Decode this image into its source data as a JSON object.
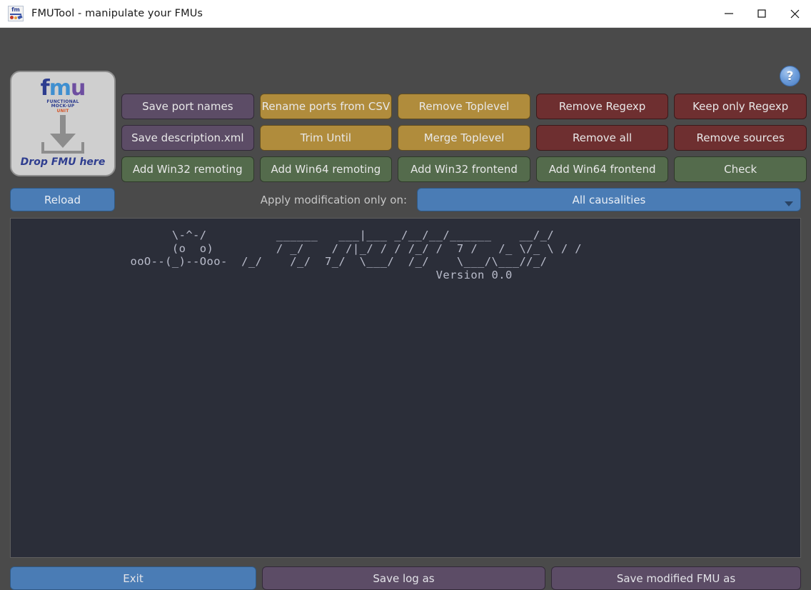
{
  "window": {
    "title": "FMUTool - manipulate your FMUs",
    "icon": "fmutool-app-icon",
    "controls": {
      "minimize": "minimize-icon",
      "maximize": "maximize-icon",
      "close": "close-icon"
    }
  },
  "help": {
    "label": "?"
  },
  "dropzone": {
    "logo_f": "f",
    "logo_m": "m",
    "logo_u": "u",
    "sub_line1": "FUNCTIONAL",
    "sub_line2": "MOCK-UP",
    "sub_line3": "UNIT",
    "caption": "Drop FMU here"
  },
  "buttons": {
    "rows": [
      [
        {
          "label": "Save port names",
          "color": "purple"
        },
        {
          "label": "Rename ports from CSV",
          "color": "gold"
        },
        {
          "label": "Remove Toplevel",
          "color": "gold"
        },
        {
          "label": "Remove Regexp",
          "color": "red"
        },
        {
          "label": "Keep only Regexp",
          "color": "red"
        }
      ],
      [
        {
          "label": "Save description.xml",
          "color": "purple"
        },
        {
          "label": "Trim Until",
          "color": "gold"
        },
        {
          "label": "Merge Toplevel",
          "color": "gold"
        },
        {
          "label": "Remove all",
          "color": "red"
        },
        {
          "label": "Remove sources",
          "color": "red"
        }
      ],
      [
        {
          "label": "Add Win32 remoting",
          "color": "green"
        },
        {
          "label": "Add Win64 remoting",
          "color": "green"
        },
        {
          "label": "Add Win32 frontend",
          "color": "green"
        },
        {
          "label": "Add Win64 frontend",
          "color": "green"
        },
        {
          "label": "Check",
          "color": "green"
        }
      ]
    ]
  },
  "apply_row": {
    "reload_label": "Reload",
    "apply_label": "Apply modification only on:",
    "causality_selected": "All causalities",
    "caret_icon": "chevron-down-icon"
  },
  "log": {
    "ascii_art": "        \\-^-/          ______   ___|___ _/__/__/______    __/_/\n        (o  o)         / _/    / /|_/ / / /_/ /  7 /   /_ \\/_ \\ / /\n  ooO--(_)--Ooo-  /_/    /_/  7_/  \\___/  /_/    \\___/\\___//_/\n                                              Version 0.0",
    "version": "Version 0.0"
  },
  "bottom": {
    "exit_label": "Exit",
    "save_log_label": "Save log as",
    "save_fmu_label": "Save modified FMU as"
  },
  "colors": {
    "window_bg": "#4a4a4a",
    "titlebar_bg": "#ffffff",
    "log_bg": "#2b2e39",
    "purple": "#5c4c66",
    "gold": "#b08c3c",
    "red": "#6e2f30",
    "green": "#546b4c",
    "blue": "#4a7cb5"
  }
}
